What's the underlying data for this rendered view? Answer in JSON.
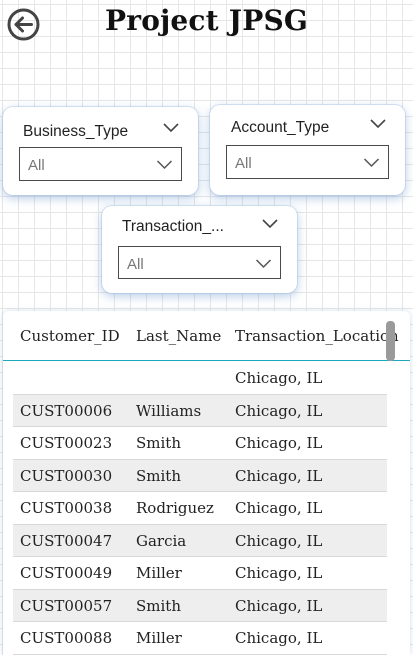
{
  "header": {
    "title": "Project JPSG",
    "back_icon": "back-arrow-circle-icon"
  },
  "slicers": [
    {
      "label": "Business_Type",
      "value": "All"
    },
    {
      "label": "Account_Type",
      "value": "All"
    },
    {
      "label": "Transaction_...",
      "value": "All"
    }
  ],
  "table": {
    "columns": [
      "Customer_ID",
      "Last_Name",
      "Transaction_Location"
    ],
    "rows": [
      [
        "",
        "",
        "Chicago, IL"
      ],
      [
        "CUST00006",
        "Williams",
        "Chicago, IL"
      ],
      [
        "CUST00023",
        "Smith",
        "Chicago, IL"
      ],
      [
        "CUST00030",
        "Smith",
        "Chicago, IL"
      ],
      [
        "CUST00038",
        "Rodriguez",
        "Chicago, IL"
      ],
      [
        "CUST00047",
        "Garcia",
        "Chicago, IL"
      ],
      [
        "CUST00049",
        "Miller",
        "Chicago, IL"
      ],
      [
        "CUST00057",
        "Smith",
        "Chicago, IL"
      ],
      [
        "CUST00088",
        "Miller",
        "Chicago, IL"
      ]
    ]
  },
  "colors": {
    "header_underline": "#1ca9bd",
    "alt_row": "#eeeeee",
    "slicer_shadow": "#78a0d2"
  }
}
